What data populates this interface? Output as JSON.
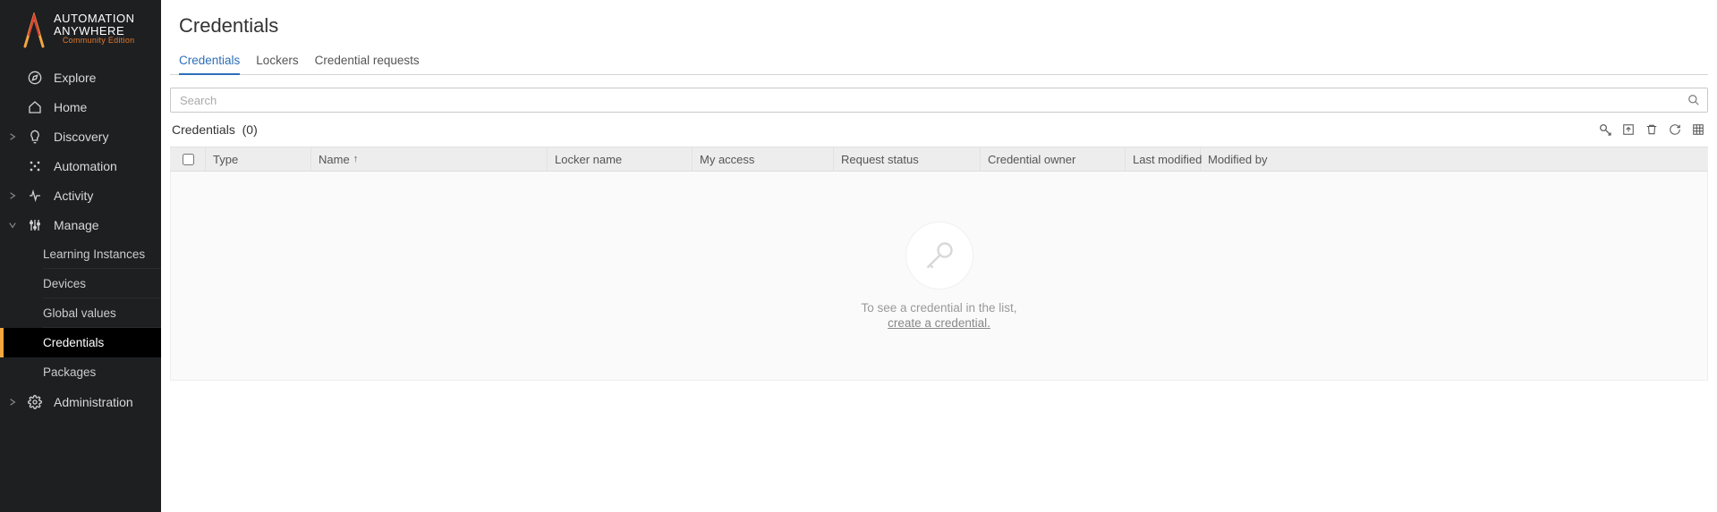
{
  "brand": {
    "line1": "AUTOMATION",
    "line2": "ANYWHERE",
    "edition": "Community Edition"
  },
  "sidebar": {
    "items": [
      {
        "label": "Explore",
        "icon": "compass",
        "expandable": false
      },
      {
        "label": "Home",
        "icon": "home",
        "expandable": false
      },
      {
        "label": "Discovery",
        "icon": "bulb",
        "expandable": true
      },
      {
        "label": "Automation",
        "icon": "dots",
        "expandable": false
      },
      {
        "label": "Activity",
        "icon": "pulse",
        "expandable": true
      },
      {
        "label": "Manage",
        "icon": "sliders",
        "expandable": true,
        "expanded": true
      },
      {
        "label": "Administration",
        "icon": "gear",
        "expandable": true
      }
    ],
    "manage_children": [
      {
        "label": "Learning Instances"
      },
      {
        "label": "Devices"
      },
      {
        "label": "Global values"
      },
      {
        "label": "Credentials",
        "active": true
      },
      {
        "label": "Packages"
      }
    ]
  },
  "page": {
    "title": "Credentials",
    "tabs": [
      "Credentials",
      "Lockers",
      "Credential requests"
    ],
    "active_tab": "Credentials",
    "search_placeholder": "Search",
    "count_label": "Credentials",
    "count": 0,
    "columns": {
      "type": "Type",
      "name": "Name",
      "locker": "Locker name",
      "access": "My access",
      "status": "Request status",
      "owner": "Credential owner",
      "last_modified": "Last modified",
      "modified_by": "Modified by"
    },
    "sort_indicator": "↑",
    "empty_message": "To see a credential in the list,",
    "empty_link": "create a credential.",
    "toolbar_icons": [
      "create-credential",
      "import",
      "delete",
      "refresh",
      "columns"
    ]
  }
}
